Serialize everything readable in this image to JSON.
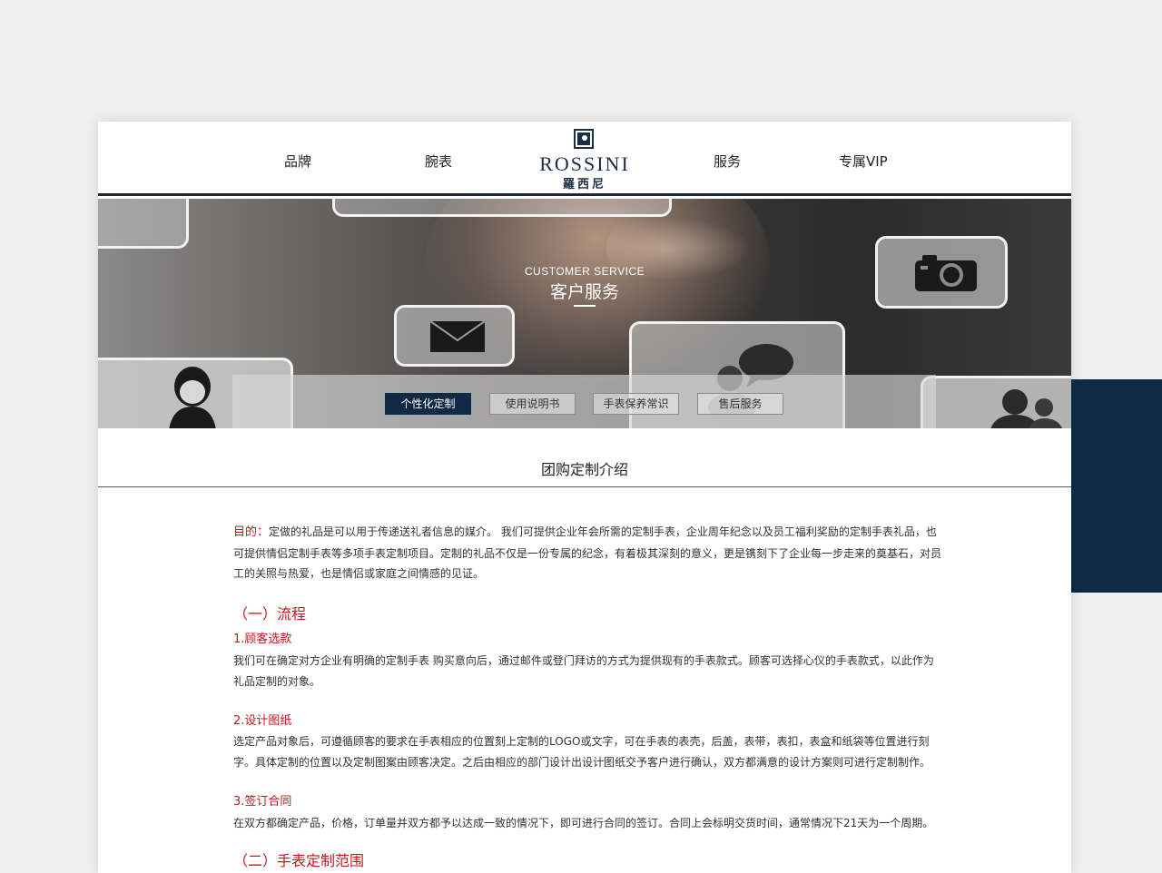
{
  "nav": {
    "items": [
      "品牌",
      "腕表",
      "服务",
      "专属VIP"
    ]
  },
  "logo": {
    "en": "ROSSINI",
    "cn": "羅西尼"
  },
  "banner": {
    "subtitle_en": "CUSTOMER SERVICE",
    "title_cn": "客户服务",
    "tabs": [
      "个性化定制",
      "使用说明书",
      "手表保养常识",
      "售后服务"
    ],
    "active_tab": "个性化定制"
  },
  "section": {
    "title": "团购定制介绍"
  },
  "content": {
    "intro_label": "目的：",
    "intro_text": "定做的礼品是可以用于传递送礼者信息的媒介。 我们可提供企业年会所需的定制手表，企业周年纪念以及员工福利奖励的定制手表礼品，也可提供情侣定制手表等多项手表定制项目。定制的礼品不仅是一份专属的纪念，有着极其深刻的意义，更是镌刻下了企业每一步走来的奠基石，对员工的关照与热爱，也是情侣或家庭之间情感的见证。",
    "heading1": "（一）流程",
    "step1_title": "1.顾客选款",
    "step1_text": "我们可在确定对方企业有明确的定制手表 购买意向后，通过邮件或登门拜访的方式为提供现有的手表款式。顾客可选择心仪的手表款式，以此作为礼品定制的对象。",
    "step2_title": "2.设计图纸",
    "step2_text": "选定产品对象后，可遵循顾客的要求在手表相应的位置刻上定制的LOGO或文字，可在手表的表壳，后盖，表带，表扣，表盒和纸袋等位置进行刻字。具体定制的位置以及定制图案由顾客决定。之后由相应的部门设计出设计图纸交予客户进行确认，双方都满意的设计方案则可进行定制制作。",
    "step3_title": "3.签订合同",
    "step3_text": "在双方都确定产品，价格，订单量并双方都予以达成一致的情况下，即可进行合同的签订。合同上会标明交货时间，通常情况下21天为一个周期。",
    "heading2": "（二）手表定制范围"
  },
  "colors": {
    "accent_navy": "#0e2a45",
    "heading_red": "#c8161d"
  },
  "icons": [
    "camera-icon",
    "mail-icon",
    "chat-icon",
    "person-icon",
    "users-icon"
  ]
}
